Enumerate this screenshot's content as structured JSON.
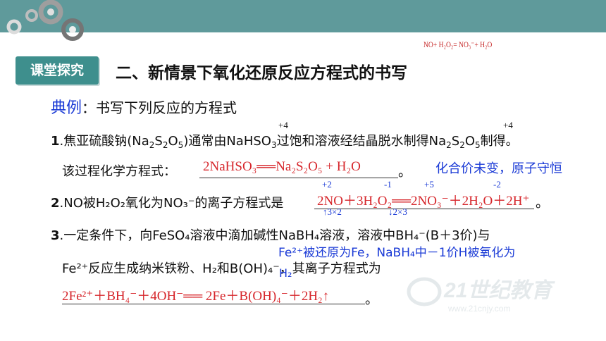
{
  "header": {
    "section_tag": "课堂探究",
    "title": "二、新情景下氧化还原反应方程式的书写",
    "corner_note": "NO+ H₂O₂= NO₃⁻+ H₂O"
  },
  "intro": {
    "label": "典例",
    "text": "：书写下列反应的方程式"
  },
  "q1": {
    "number": "1",
    "text_a": ".焦亚硫酸钠(Na",
    "text_b": "2",
    "text_c": "S",
    "text_d": "2",
    "text_e": "O",
    "text_f": "5",
    "text_g": ")通常由NaHSO",
    "text_h": "3",
    "text_i": "过饱和溶液经结晶脱水制得Na",
    "text_j": "2",
    "text_k": "S",
    "text_l": "2",
    "text_m": "O",
    "text_n": "5",
    "text_o": "制得。",
    "ox1": "+4",
    "ox2": "+4",
    "prompt": "该过程化学方程式：",
    "answer": "2NaHSO₃══Na₂S₂O₅ + H₂O",
    "end": "。",
    "note": "化合价未变，原子守恒"
  },
  "q2": {
    "number": "2",
    "text": ".NO被H₂O₂氧化为NO₃⁻的离子方程式是",
    "answer": "2NO＋3H₂O₂══2NO₃⁻＋2H₂O＋2H⁺",
    "end": "。",
    "ox_plus2": "+2",
    "ox_minus1": "-1",
    "ox_plus5": "+5",
    "ox_minus2": "-2",
    "arrow_up": "↑3×2",
    "arrow_down": "↓2×3"
  },
  "q3": {
    "number": "3",
    "text_line1": ".一定条件下，向FeSO₄溶液中滴加碱性NaBH₄溶液，溶液中BH₄⁻(B＋3价)与",
    "text_line2": "Fe²⁺反应生成纳米铁粉、H₂和B(OH)₄⁻，其离子方程式为",
    "note": "Fe²⁺被还原为Fe，NaBH₄中－1价H被氧化为",
    "note_h2": "H₂",
    "answer": "2Fe²⁺＋BH₄⁻＋4OH⁻══ 2Fe＋B(OH)₄⁻＋2H₂↑",
    "end": "。"
  },
  "watermark": {
    "text": "21世纪教育",
    "url": "www.21cnjy.com"
  },
  "colors": {
    "topbar": "#5f9a9b",
    "tag": "#3e8f8d",
    "answer": "#d6262b",
    "note": "#1a3ad6"
  }
}
